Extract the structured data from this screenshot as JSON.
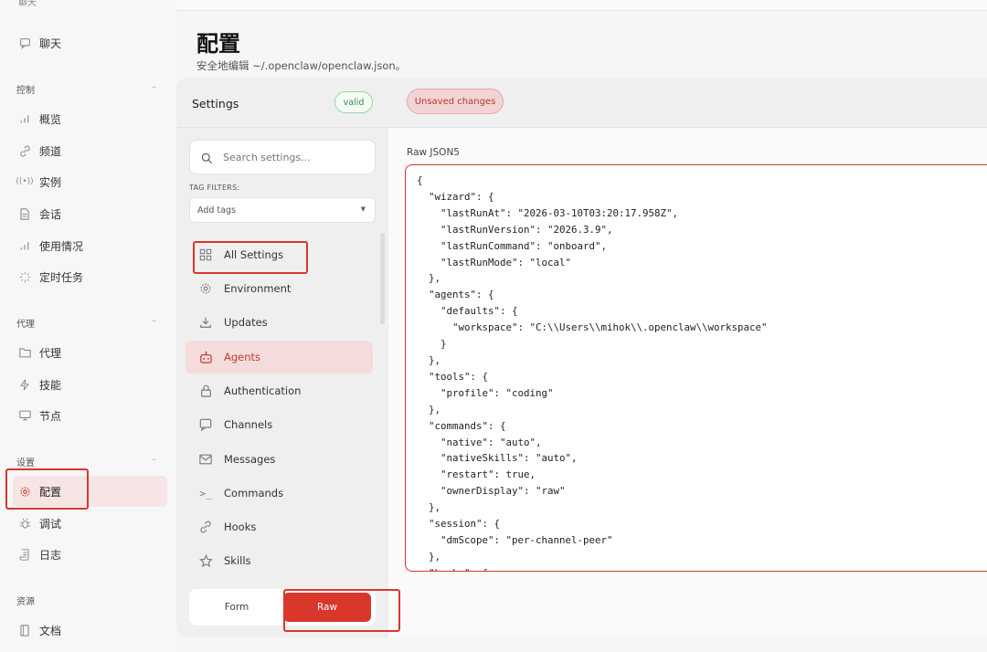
{
  "nav": {
    "top_cut": "聊天",
    "items_chat": [
      {
        "label": "聊天",
        "icon": "chat-bubble-icon"
      }
    ],
    "groups": [
      {
        "label": "控制",
        "collapse": "–"
      },
      {
        "label": "代理",
        "collapse": "–"
      },
      {
        "label": "设置",
        "collapse": "–"
      },
      {
        "label": "资源"
      }
    ],
    "control_items": [
      {
        "label": "概览",
        "icon": "bar-chart-icon"
      },
      {
        "label": "频道",
        "icon": "link-icon"
      },
      {
        "label": "实例",
        "icon": "radio-icon"
      },
      {
        "label": "会话",
        "icon": "document-icon"
      },
      {
        "label": "使用情况",
        "icon": "bar-chart-icon"
      },
      {
        "label": "定时任务",
        "icon": "loader-icon"
      }
    ],
    "agent_items": [
      {
        "label": "代理",
        "icon": "folder-icon"
      },
      {
        "label": "技能",
        "icon": "lightning-icon"
      },
      {
        "label": "节点",
        "icon": "monitor-icon"
      }
    ],
    "settings_items": [
      {
        "label": "配置",
        "icon": "gear-icon"
      },
      {
        "label": "调试",
        "icon": "bug-icon"
      },
      {
        "label": "日志",
        "icon": "scroll-icon"
      }
    ],
    "resource_items": [
      {
        "label": "文档",
        "icon": "book-icon"
      }
    ]
  },
  "header": {
    "title": "配置",
    "subtitle": "安全地编辑 ~/.openclaw/openclaw.json。"
  },
  "settings": {
    "title": "Settings",
    "badge": "valid",
    "search_placeholder": "Search settings...",
    "tag_filters_label": "TAG FILTERS:",
    "tag_select_value": "Add tags",
    "categories": [
      {
        "label": "All Settings",
        "icon": "grid-icon"
      },
      {
        "label": "Environment",
        "icon": "gear-icon"
      },
      {
        "label": "Updates",
        "icon": "download-icon"
      },
      {
        "label": "Agents",
        "icon": "robot-icon",
        "active": true
      },
      {
        "label": "Authentication",
        "icon": "lock-icon"
      },
      {
        "label": "Channels",
        "icon": "chat-bubble-icon"
      },
      {
        "label": "Messages",
        "icon": "mail-icon"
      },
      {
        "label": "Commands",
        "icon": "terminal-icon"
      },
      {
        "label": "Hooks",
        "icon": "link-icon"
      },
      {
        "label": "Skills",
        "icon": "star-icon"
      }
    ],
    "mode_form": "Form",
    "mode_raw": "Raw"
  },
  "editor": {
    "unsaved": "Unsaved changes",
    "raw_label": "Raw JSON5",
    "content": "{\n  \"wizard\": {\n    \"lastRunAt\": \"2026-03-10T03:20:17.958Z\",\n    \"lastRunVersion\": \"2026.3.9\",\n    \"lastRunCommand\": \"onboard\",\n    \"lastRunMode\": \"local\"\n  },\n  \"agents\": {\n    \"defaults\": {\n      \"workspace\": \"C:\\\\Users\\\\mihok\\\\.openclaw\\\\workspace\"\n    }\n  },\n  \"tools\": {\n    \"profile\": \"coding\"\n  },\n  \"commands\": {\n    \"native\": \"auto\",\n    \"nativeSkills\": \"auto\",\n    \"restart\": true,\n    \"ownerDisplay\": \"raw\"\n  },\n  \"session\": {\n    \"dmScope\": \"per-channel-peer\"\n  },\n  \"hooks\": {"
  },
  "colors": {
    "accent": "#d9362c",
    "active_bg": "#f4dcdc",
    "valid": "#3a8a4a"
  }
}
